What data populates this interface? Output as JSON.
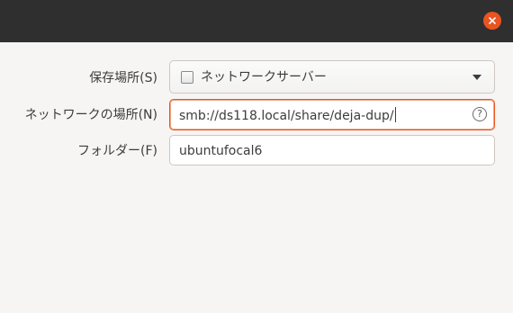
{
  "titlebar": {
    "close_icon": "close-icon",
    "close_color": "#e95420"
  },
  "form": {
    "storage_label": "保存場所(S)",
    "storage_value": "ネットワークサーバー",
    "storage_checkbox_icon": "checkbox-icon",
    "network_label": "ネットワークの場所(N)",
    "network_value": "smb://ds118.local/share/deja-dup/",
    "network_help_icon": "?",
    "folder_label": "フォルダー(F)",
    "folder_value": "ubuntufocal6"
  },
  "colors": {
    "accent": "#e95420",
    "titlebar": "#2f2f2f",
    "background": "#f6f5f4"
  }
}
